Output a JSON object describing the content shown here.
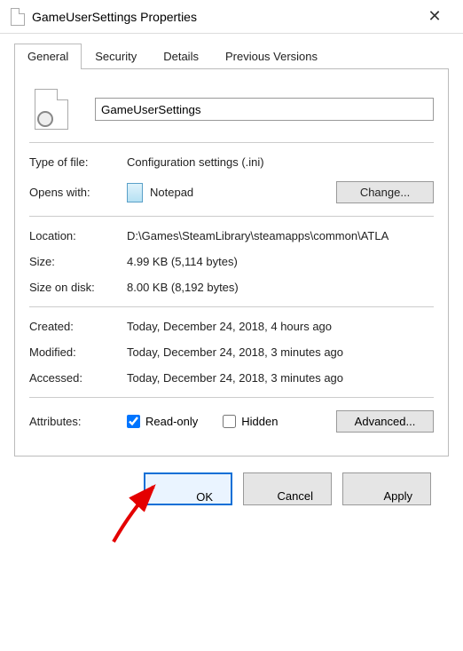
{
  "window": {
    "title": "GameUserSettings Properties"
  },
  "tabs": {
    "general": "General",
    "security": "Security",
    "details": "Details",
    "previous": "Previous Versions"
  },
  "file": {
    "name_value": "GameUserSettings"
  },
  "labels": {
    "type_of_file": "Type of file:",
    "opens_with": "Opens with:",
    "location": "Location:",
    "size": "Size:",
    "size_on_disk": "Size on disk:",
    "created": "Created:",
    "modified": "Modified:",
    "accessed": "Accessed:",
    "attributes": "Attributes:"
  },
  "values": {
    "type_of_file": "Configuration settings (.ini)",
    "opens_with_app": "Notepad",
    "location": "D:\\Games\\SteamLibrary\\steamapps\\common\\ATLA",
    "size": "4.99 KB (5,114 bytes)",
    "size_on_disk": "8.00 KB (8,192 bytes)",
    "created": "Today, December 24, 2018, 4 hours ago",
    "modified": "Today, December 24, 2018, 3 minutes ago",
    "accessed": "Today, December 24, 2018, 3 minutes ago"
  },
  "attributes": {
    "read_only_label": "Read-only",
    "read_only_checked": true,
    "hidden_label": "Hidden",
    "hidden_checked": false
  },
  "buttons": {
    "change": "Change...",
    "advanced": "Advanced...",
    "ok": "OK",
    "cancel": "Cancel",
    "apply": "Apply"
  }
}
